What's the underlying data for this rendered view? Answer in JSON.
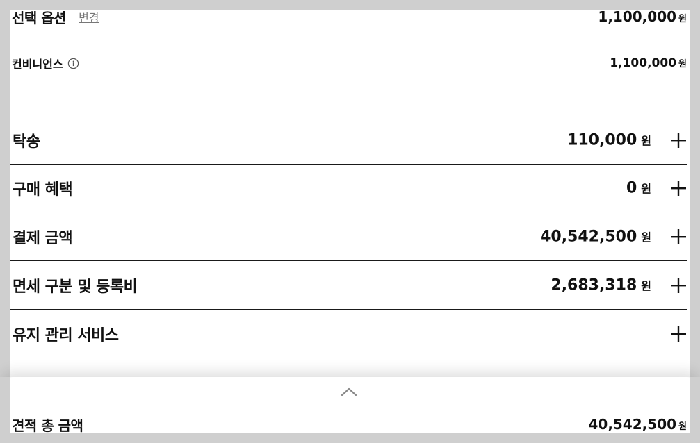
{
  "option": {
    "title": "선택 옵션",
    "change_label": "변경",
    "price": "1,100,000",
    "currency": "원"
  },
  "convenience": {
    "label": "컨비니언스",
    "price": "1,100,000",
    "currency": "원",
    "icon": "info-icon"
  },
  "accordion": [
    {
      "label": "탁송",
      "amount": "110,000",
      "currency": "원"
    },
    {
      "label": "구매 혜택",
      "amount": "0",
      "currency": "원"
    },
    {
      "label": "결제 금액",
      "amount": "40,542,500",
      "currency": "원"
    },
    {
      "label": "면세 구분 및 등록비",
      "amount": "2,683,318",
      "currency": "원"
    },
    {
      "label": "유지 관리 서비스",
      "amount": "",
      "currency": ""
    }
  ],
  "summary": {
    "total_label": "견적 총 금액",
    "total_amount": "40,542,500",
    "currency": "원",
    "toggle_icon": "chevron-up-icon"
  },
  "colors": {
    "background": "#cfcfcf",
    "panel": "#ffffff",
    "text": "#111111",
    "muted": "#777777",
    "divider": "#1a1a1a"
  }
}
